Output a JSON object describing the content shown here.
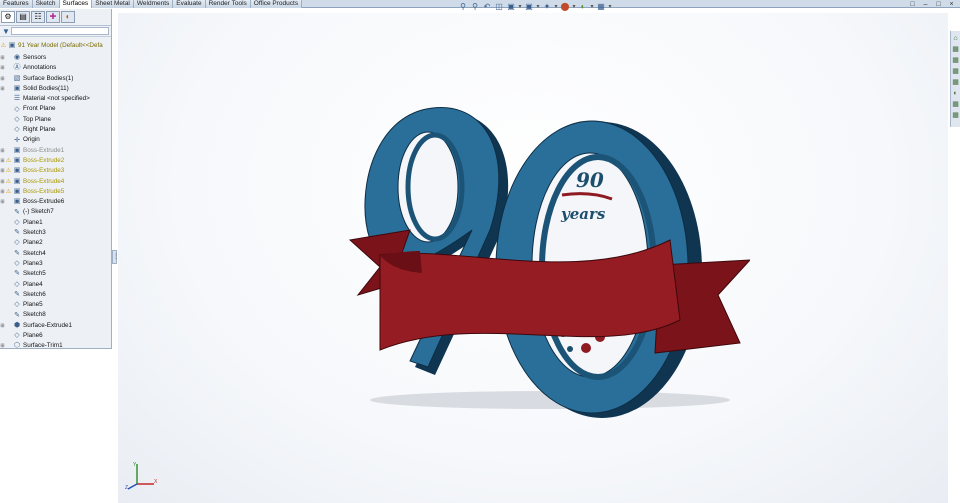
{
  "command_tabs": [
    {
      "label": "Features",
      "active": false
    },
    {
      "label": "Sketch",
      "active": false
    },
    {
      "label": "Surfaces",
      "active": true
    },
    {
      "label": "Sheet Metal",
      "active": false
    },
    {
      "label": "Weldments",
      "active": false
    },
    {
      "label": "Evaluate",
      "active": false
    },
    {
      "label": "Render Tools",
      "active": false
    },
    {
      "label": "Office Products",
      "active": false
    }
  ],
  "headsup_icons": [
    "zoom-to-fit-icon",
    "zoom-area-icon",
    "previous-view-icon",
    "section-view-icon",
    "view-orientation-icon",
    "display-style-icon",
    "hide-show-icon",
    "appearance-icon",
    "scene-icon",
    "view-settings-icon"
  ],
  "feature_tree": {
    "filter_placeholder": "",
    "root": "91 Year Model  (Default<<Defa",
    "items": [
      {
        "label": "Sensors",
        "icon": "sensor-icon",
        "expander": "+",
        "warn": false,
        "style": "normal"
      },
      {
        "label": "Annotations",
        "icon": "annotation-icon",
        "expander": "+",
        "warn": false,
        "style": "normal"
      },
      {
        "label": "Surface Bodies(1)",
        "icon": "surface-bodies-icon",
        "expander": "+",
        "warn": false,
        "style": "normal"
      },
      {
        "label": "Solid Bodies(11)",
        "icon": "solid-bodies-icon",
        "expander": "+",
        "warn": false,
        "style": "normal"
      },
      {
        "label": "Material <not specified>",
        "icon": "material-icon",
        "expander": "",
        "warn": false,
        "style": "normal"
      },
      {
        "label": "Front Plane",
        "icon": "plane-icon",
        "expander": "",
        "warn": false,
        "style": "normal"
      },
      {
        "label": "Top Plane",
        "icon": "plane-icon",
        "expander": "",
        "warn": false,
        "style": "normal"
      },
      {
        "label": "Right Plane",
        "icon": "plane-icon",
        "expander": "",
        "warn": false,
        "style": "normal"
      },
      {
        "label": "Origin",
        "icon": "origin-icon",
        "expander": "",
        "warn": false,
        "style": "normal"
      },
      {
        "label": "Boss-Extrude1",
        "icon": "extrude-icon",
        "expander": "+",
        "warn": false,
        "style": "gray"
      },
      {
        "label": "Boss-Extrude2",
        "icon": "extrude-icon",
        "expander": "+",
        "warn": true,
        "style": "yellow"
      },
      {
        "label": "Boss-Extrude3",
        "icon": "extrude-icon",
        "expander": "+",
        "warn": true,
        "style": "yellow"
      },
      {
        "label": "Boss-Extrude4",
        "icon": "extrude-icon",
        "expander": "+",
        "warn": true,
        "style": "yellow"
      },
      {
        "label": "Boss-Extrude5",
        "icon": "extrude-icon",
        "expander": "+",
        "warn": true,
        "style": "yellow"
      },
      {
        "label": "Boss-Extrude6",
        "icon": "extrude-icon",
        "expander": "+",
        "warn": false,
        "style": "normal"
      },
      {
        "label": "(-) Sketch7",
        "icon": "sketch-icon",
        "expander": "",
        "warn": false,
        "style": "normal"
      },
      {
        "label": "Plane1",
        "icon": "plane-icon",
        "expander": "",
        "warn": false,
        "style": "normal"
      },
      {
        "label": "Sketch3",
        "icon": "sketch-icon",
        "expander": "",
        "warn": false,
        "style": "normal"
      },
      {
        "label": "Plane2",
        "icon": "plane-icon",
        "expander": "",
        "warn": false,
        "style": "normal"
      },
      {
        "label": "Sketch4",
        "icon": "sketch-icon",
        "expander": "",
        "warn": false,
        "style": "normal"
      },
      {
        "label": "Plane3",
        "icon": "plane-icon",
        "expander": "",
        "warn": false,
        "style": "normal"
      },
      {
        "label": "Sketch5",
        "icon": "sketch-icon",
        "expander": "",
        "warn": false,
        "style": "normal"
      },
      {
        "label": "Plane4",
        "icon": "plane-icon",
        "expander": "",
        "warn": false,
        "style": "normal"
      },
      {
        "label": "Sketch6",
        "icon": "sketch-icon",
        "expander": "",
        "warn": false,
        "style": "normal"
      },
      {
        "label": "Plane5",
        "icon": "plane-icon",
        "expander": "",
        "warn": false,
        "style": "normal"
      },
      {
        "label": "Sketch8",
        "icon": "sketch-icon",
        "expander": "",
        "warn": false,
        "style": "normal"
      },
      {
        "label": "Surface-Extrude1",
        "icon": "surface-extrude-icon",
        "expander": "+",
        "warn": false,
        "style": "normal"
      },
      {
        "label": "Plane6",
        "icon": "plane-icon",
        "expander": "",
        "warn": false,
        "style": "normal"
      },
      {
        "label": "Surface-Trim1",
        "icon": "surface-trim-icon",
        "expander": "+",
        "warn": false,
        "style": "normal"
      }
    ]
  },
  "model": {
    "emblem_number": "90",
    "emblem_word": "years",
    "colors": {
      "digits": "#1f5f86",
      "digits_edge": "#0f3550",
      "ribbon": "#8e1a22",
      "ribbon_dark": "#5a0c12",
      "shadow": "#c9cdd3"
    }
  },
  "triad_axes": {
    "x": "X",
    "y": "Y",
    "z": "Z"
  }
}
